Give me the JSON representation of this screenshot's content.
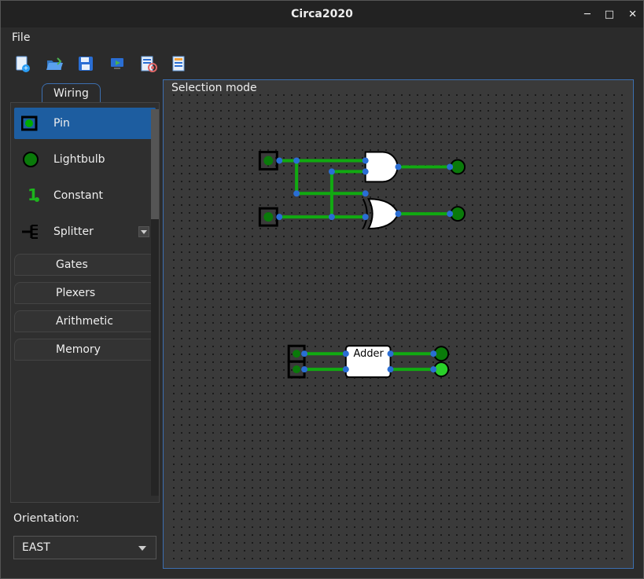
{
  "window": {
    "title": "Circa2020"
  },
  "menubar": {
    "file": "File"
  },
  "toolbar": {
    "icons": [
      "new-file-icon",
      "open-folder-icon",
      "save-icon",
      "run-icon",
      "settings-icon",
      "sheet-icon"
    ]
  },
  "tabs": {
    "wiring": "Wiring"
  },
  "palette": {
    "components": [
      {
        "name": "Pin",
        "selected": true
      },
      {
        "name": "Lightbulb",
        "selected": false
      },
      {
        "name": "Constant",
        "selected": false
      },
      {
        "name": "Splitter",
        "selected": false,
        "expandable": true
      }
    ],
    "categories": [
      "Gates",
      "Plexers",
      "Arithmetic",
      "Memory"
    ]
  },
  "properties": {
    "orientation_label": "Orientation:",
    "orientation_value": "EAST"
  },
  "canvas": {
    "mode_label": "Selection mode",
    "components": {
      "adder_label": "Adder"
    }
  }
}
